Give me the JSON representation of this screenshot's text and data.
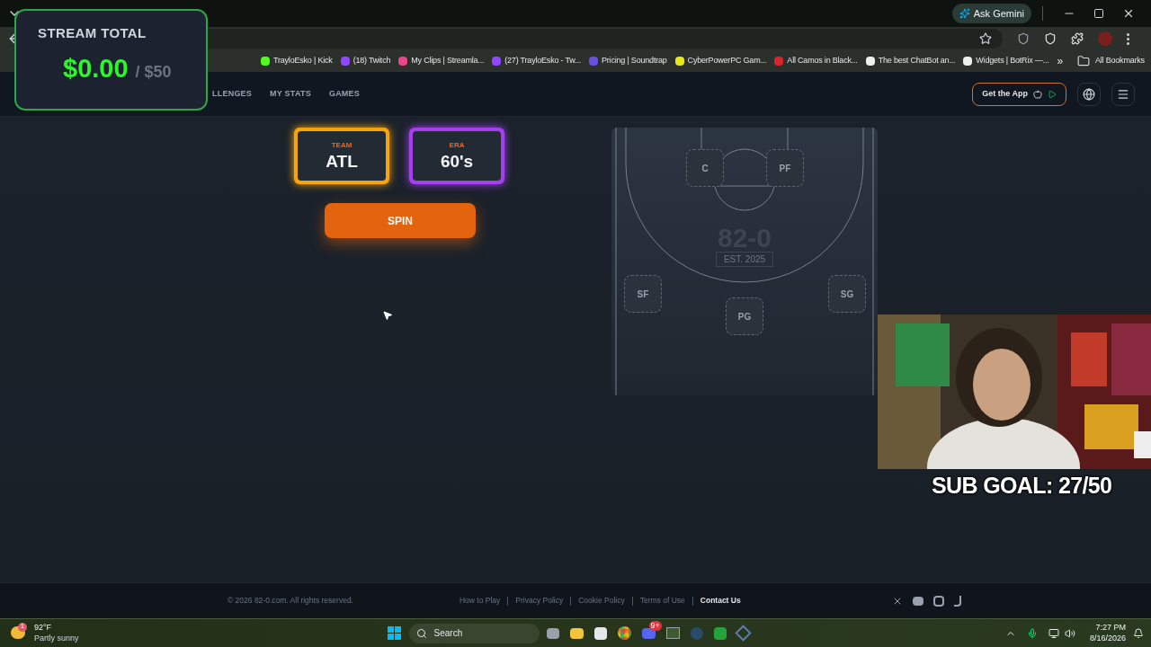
{
  "browser": {
    "ask_gemini": "Ask Gemini",
    "bookmarks": [
      {
        "label": "TrayloEsko | Kick",
        "color": "#53fc18"
      },
      {
        "label": "(18) Twitch",
        "color": "#9146ff"
      },
      {
        "label": "My Clips | Streamla...",
        "color": "#e8478b"
      },
      {
        "label": "(27) TrayloEsko - Tw...",
        "color": "#9146ff"
      },
      {
        "label": "Pricing | Soundtrap",
        "color": "#6b4fe0"
      },
      {
        "label": "CyberPowerPC Gam...",
        "color": "#e6e619"
      },
      {
        "label": "All Camos in Black...",
        "color": "#d9262b"
      },
      {
        "label": "The best ChatBot an...",
        "color": "#eeeeee"
      },
      {
        "label": "Widgets | BotRix —...",
        "color": "#eeeeee"
      }
    ],
    "more": "»",
    "all_bookmarks": "All Bookmarks"
  },
  "site": {
    "nav": [
      "LLENGES",
      "MY STATS",
      "GAMES"
    ],
    "get_app": "Get the App"
  },
  "spin": {
    "cards": [
      {
        "label": "TEAM",
        "value": "ATL",
        "color": "#f5a40c"
      },
      {
        "label": "ERA",
        "value": "60's",
        "color": "#a63ff0"
      }
    ],
    "button": "SPIN"
  },
  "court": {
    "logo": "82-0",
    "logo_sub": "EST. 2025",
    "slots": [
      "C",
      "PF",
      "SF",
      "PG",
      "SG"
    ]
  },
  "footer": {
    "copyright": "© 2026 82-0.com. All rights reserved.",
    "links": [
      {
        "label": "How to Play",
        "emphasis": false
      },
      {
        "label": "Privacy Policy",
        "emphasis": false
      },
      {
        "label": "Cookie Policy",
        "emphasis": false
      },
      {
        "label": "Terms of Use",
        "emphasis": false
      },
      {
        "label": "Contact Us",
        "emphasis": true
      }
    ]
  },
  "overlay": {
    "title": "STREAM TOTAL",
    "amount": "$0.00",
    "goal": "/ $50"
  },
  "sub_goal": "SUB GOAL: 27/50",
  "taskbar": {
    "weather_temp": "92°F",
    "weather_text": "Partly sunny",
    "weather_badge": "1",
    "search": "Search",
    "discord_badge": "9+",
    "time": "7:27 PM",
    "date": "8/16/2026"
  }
}
